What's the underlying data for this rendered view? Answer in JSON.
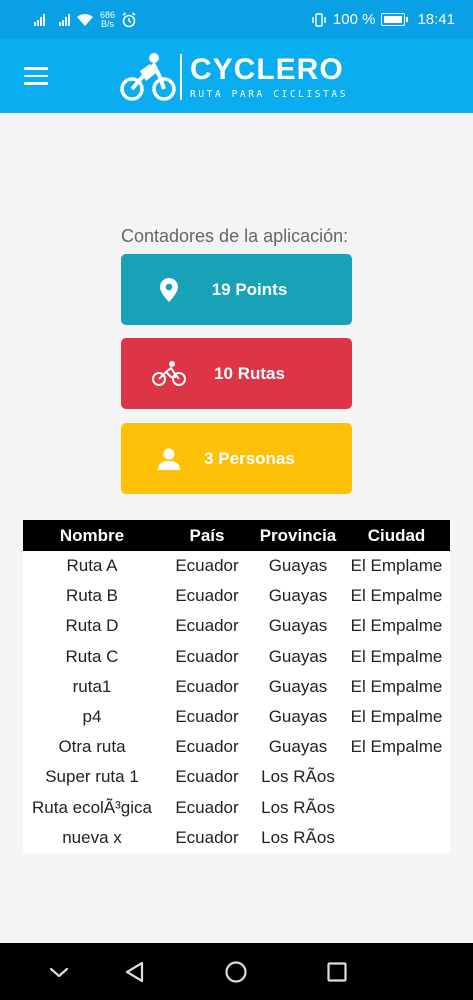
{
  "status_bar": {
    "net_speed_value": "686",
    "net_speed_unit": "B/s",
    "battery": "100 %",
    "time": "18:41",
    "icons": [
      "signal-icon",
      "signal-icon",
      "wifi-icon",
      "alarm-icon",
      "vibrate-icon",
      "battery-icon"
    ]
  },
  "header": {
    "menu_icon": "hamburger-menu-icon",
    "logo_title": "CYCLERO",
    "logo_subtitle": "RUTA PARA CICLISTAS",
    "brand_color": "#0aaef0"
  },
  "counters": {
    "label": "Contadores de la aplicación:",
    "items": [
      {
        "icon": "map-marker-icon",
        "label": "19 Points",
        "color": "#17a2b8"
      },
      {
        "icon": "bicycle-icon",
        "label": "10 Rutas",
        "color": "#dc3545"
      },
      {
        "icon": "person-icon",
        "label": "3 Personas",
        "color": "#ffc107"
      }
    ]
  },
  "table": {
    "headers": [
      "Nombre",
      "País",
      "Provincia",
      "Ciudad"
    ],
    "rows": [
      [
        "Ruta A",
        "Ecuador",
        "Guayas",
        "El Emplame"
      ],
      [
        "Ruta B",
        "Ecuador",
        "Guayas",
        "El Empalme"
      ],
      [
        "Ruta D",
        "Ecuador",
        "Guayas",
        "El Empalme"
      ],
      [
        "Ruta C",
        "Ecuador",
        "Guayas",
        "El Empalme"
      ],
      [
        "ruta1",
        "Ecuador",
        "Guayas",
        "El Empalme"
      ],
      [
        "p4",
        "Ecuador",
        "Guayas",
        "El Empalme"
      ],
      [
        "Otra ruta",
        "Ecuador",
        "Guayas",
        "El Empalme"
      ],
      [
        "Super ruta 1",
        "Ecuador",
        "Los RÃos",
        ""
      ],
      [
        "Ruta ecolÃ³gica",
        "Ecuador",
        "Los RÃos",
        ""
      ],
      [
        "nueva x",
        "Ecuador",
        "Los RÃos",
        ""
      ]
    ]
  },
  "nav_bar": {
    "icons": [
      "chevron-down-icon",
      "back-icon",
      "home-icon",
      "recents-icon"
    ]
  }
}
